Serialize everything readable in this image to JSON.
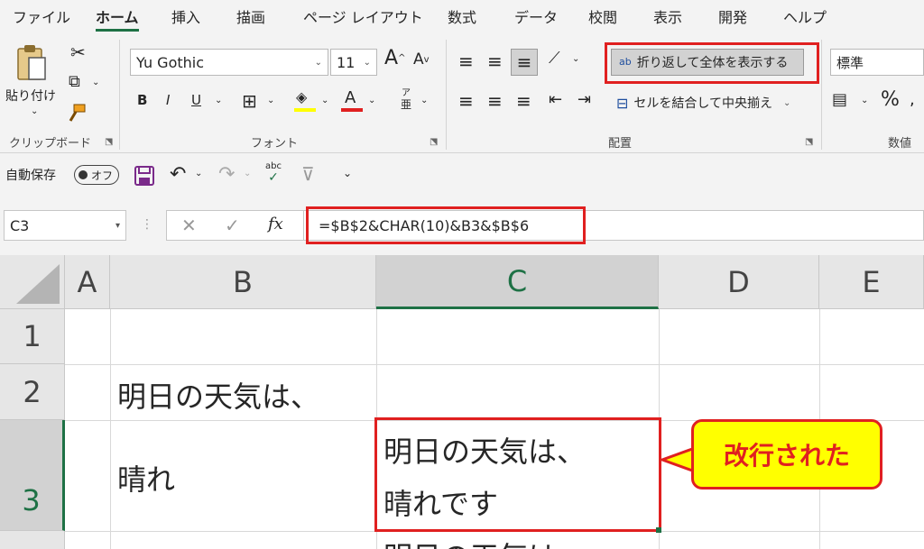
{
  "menu": {
    "tabs": [
      "ファイル",
      "ホーム",
      "挿入",
      "描画",
      "ページ レイアウト",
      "数式",
      "データ",
      "校閲",
      "表示",
      "開発",
      "ヘルプ"
    ]
  },
  "ribbon": {
    "clipboard": {
      "paste_label": "貼り付け",
      "group_label": "クリップボード"
    },
    "font": {
      "font_name": "Yu Gothic",
      "font_size": "11",
      "grow_label": "A",
      "shrink_label": "A",
      "bold": "B",
      "italic": "I",
      "underline": "U",
      "phonetic_top": "ア",
      "phonetic_bottom": "亜",
      "font_color_label": "A",
      "group_label": "フォント"
    },
    "alignment": {
      "wrap_text_label": "折り返して全体を表示する",
      "wrap_icon_label": "ab",
      "merge_label": "セルを結合して中央揃え",
      "group_label": "配置"
    },
    "number": {
      "format": "標準",
      "percent": "%",
      "group_label": "数値"
    }
  },
  "qat": {
    "autosave_label": "自動保存",
    "toggle_state": "オフ",
    "spell_label": "abc"
  },
  "formula_bar": {
    "name_box": "C3",
    "fx": "fx",
    "formula": "=$B$2&CHAR(10)&B3&$B$6"
  },
  "sheet": {
    "columns": [
      "A",
      "B",
      "C",
      "D",
      "E"
    ],
    "rows": [
      "1",
      "2",
      "3"
    ],
    "cells": {
      "B2": "明日の天気は、",
      "B3": "晴れ",
      "C3_line1": "明日の天気は、",
      "C3_line2": "晴れです",
      "C4_partial": "明日の天気は、"
    }
  },
  "annotation": {
    "callout_text": "改行された"
  },
  "colors": {
    "excel_green": "#1e7145",
    "highlight_red": "#e02020",
    "callout_yellow": "#ffff00"
  }
}
